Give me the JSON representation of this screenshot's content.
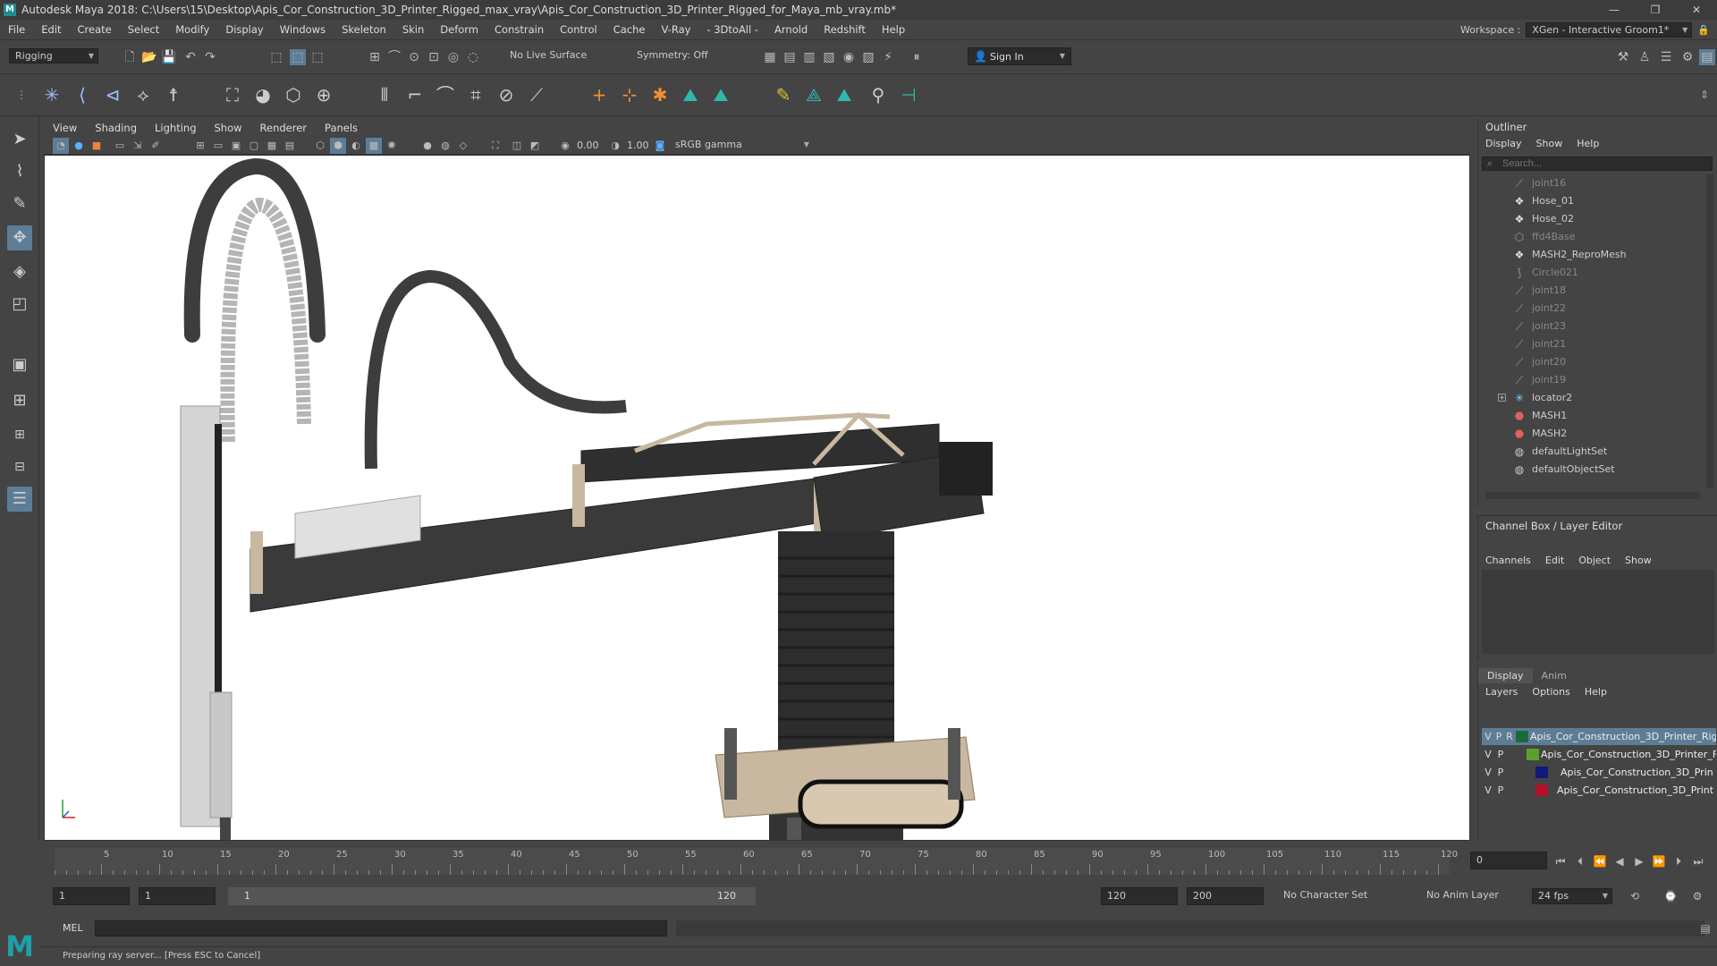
{
  "title": "Autodesk Maya 2018: C:\\Users\\15\\Desktop\\Apis_Cor_Construction_3D_Printer_Rigged_max_vray\\Apis_Cor_Construction_3D_Printer_Rigged_for_Maya_mb_vray.mb*",
  "menubar": [
    "File",
    "Edit",
    "Create",
    "Select",
    "Modify",
    "Display",
    "Windows",
    "Skeleton",
    "Skin",
    "Deform",
    "Constrain",
    "Control",
    "Cache",
    "V-Ray",
    "- 3DtoAll -",
    "Arnold",
    "Redshift",
    "Help"
  ],
  "workspace": {
    "label": "Workspace :",
    "value": "XGen - Interactive Groom1*"
  },
  "statusline": {
    "mode": "Rigging",
    "live_surface": "No Live Surface",
    "symmetry": "Symmetry: Off",
    "sign_in": "Sign In"
  },
  "viewport": {
    "menu": [
      "View",
      "Shading",
      "Lighting",
      "Show",
      "Renderer",
      "Panels"
    ],
    "exposure": "0.00",
    "gamma": "1.00",
    "color_space": "sRGB gamma"
  },
  "outliner": {
    "title": "Outliner",
    "menu": [
      "Display",
      "Show",
      "Help"
    ],
    "search_placeholder": "Search...",
    "items": [
      {
        "label": "joint16",
        "icon": "joint-icon",
        "dim": true
      },
      {
        "label": "Hose_01",
        "icon": "mesh-icon",
        "dim": false
      },
      {
        "label": "Hose_02",
        "icon": "mesh-icon",
        "dim": false
      },
      {
        "label": "ffd4Base",
        "icon": "ffd-icon",
        "dim": true
      },
      {
        "label": "MASH2_ReproMesh",
        "icon": "mesh-icon",
        "dim": false
      },
      {
        "label": "Circle021",
        "icon": "curve-icon",
        "dim": true
      },
      {
        "label": "joint18",
        "icon": "joint-icon",
        "dim": true
      },
      {
        "label": "joint22",
        "icon": "joint-icon",
        "dim": true
      },
      {
        "label": "joint23",
        "icon": "joint-icon",
        "dim": true
      },
      {
        "label": "joint21",
        "icon": "joint-icon",
        "dim": true
      },
      {
        "label": "joint20",
        "icon": "joint-icon",
        "dim": true
      },
      {
        "label": "joint19",
        "icon": "joint-icon",
        "dim": true
      },
      {
        "label": "locator2",
        "icon": "locator-icon",
        "dim": false,
        "expand": "+"
      },
      {
        "label": "MASH1",
        "icon": "mash-icon",
        "dim": false
      },
      {
        "label": "MASH2",
        "icon": "mash-icon",
        "dim": false
      },
      {
        "label": "defaultLightSet",
        "icon": "set-icon",
        "dim": false
      },
      {
        "label": "defaultObjectSet",
        "icon": "set-icon",
        "dim": false
      }
    ]
  },
  "channelbox": {
    "title": "Channel Box / Layer Editor",
    "menu": [
      "Channels",
      "Edit",
      "Object",
      "Show"
    ]
  },
  "layers": {
    "tabs": [
      "Display",
      "Anim"
    ],
    "menu": [
      "Layers",
      "Options",
      "Help"
    ],
    "rows": [
      {
        "v": "V",
        "p": "P",
        "r": "R",
        "color": "#1a6b3a",
        "name": "Apis_Cor_Construction_3D_Printer_Rig",
        "selected": true
      },
      {
        "v": "V",
        "p": "P",
        "color": "#5aa02c",
        "name": "Apis_Cor_Construction_3D_Printer_F",
        "selected": false
      },
      {
        "v": "V",
        "p": "P",
        "color": "#101a78",
        "name": "Apis_Cor_Construction_3D_Prin",
        "selected": false
      },
      {
        "v": "V",
        "p": "P",
        "color": "#b0102a",
        "name": "Apis_Cor_Construction_3D_Print",
        "selected": false
      }
    ]
  },
  "timeline": {
    "ticks": [
      "5",
      "10",
      "15",
      "20",
      "25",
      "30",
      "35",
      "40",
      "45",
      "50",
      "55",
      "60",
      "65",
      "70",
      "75",
      "80",
      "85",
      "90",
      "95",
      "100",
      "105",
      "110",
      "115",
      "120"
    ],
    "current_frame": "0"
  },
  "range": {
    "start": "1",
    "inner_start": "1",
    "slider_start": "1",
    "slider_end": "120",
    "end": "120",
    "max": "200",
    "character_set": "No Character Set",
    "anim_layer": "No Anim Layer",
    "fps": "24 fps"
  },
  "cmdline": {
    "label": "MEL"
  },
  "helpline": {
    "text": "Preparing ray server... [Press ESC to Cancel]"
  }
}
